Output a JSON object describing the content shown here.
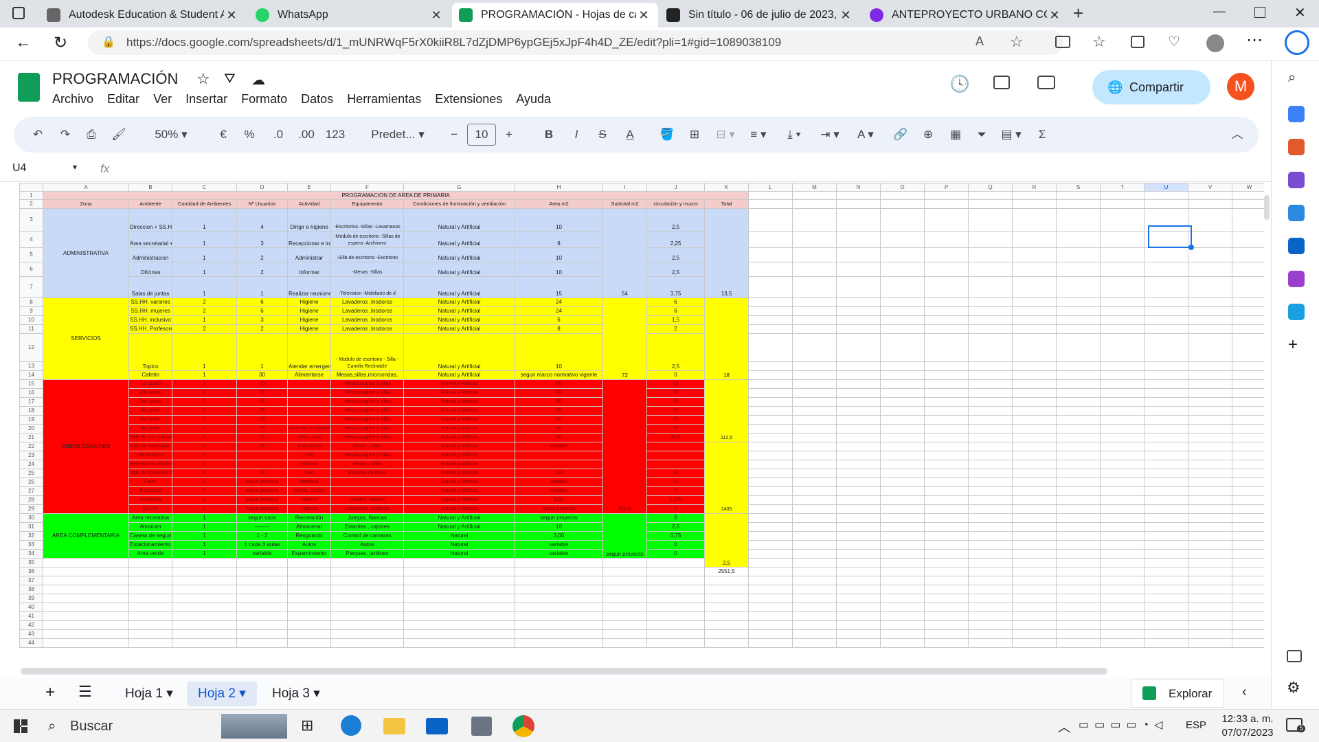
{
  "browser": {
    "tabs": [
      {
        "title": "Autodesk Education & Student A",
        "icon": "autodesk-icon",
        "color": "#666666"
      },
      {
        "title": "WhatsApp",
        "icon": "whatsapp-icon",
        "color": "#25d366"
      },
      {
        "title": "PROGRAMACIÓN - Hojas de cálc",
        "icon": "sheets-icon",
        "color": "#0f9d58"
      },
      {
        "title": "Sin título - 06 de julio de 2023, 1",
        "icon": "autodesk-a-icon",
        "color": "#222222"
      },
      {
        "title": "ANTEPROYECTO URBANO COLE",
        "icon": "canva-icon",
        "color": "#7d2ae8"
      }
    ],
    "url": "https://docs.google.com/spreadsheets/d/1_mUNRWqF5rX0kiiR8L7dZjDMP6ypGEj5xJpF4h4D_ZE/edit?pli=1#gid=1089038109"
  },
  "doc": {
    "title": "PROGRAMACIÓN",
    "menu": [
      "Archivo",
      "Editar",
      "Ver",
      "Insertar",
      "Formato",
      "Datos",
      "Herramientas",
      "Extensiones",
      "Ayuda"
    ],
    "share_label": "Compartir",
    "avatar_letter": "M"
  },
  "toolbar": {
    "zoom": "50%",
    "currency": "€",
    "percent": "%",
    "dec_less": ".0",
    "dec_more": ".00",
    "format_123": "123",
    "font": "Predet...",
    "font_size": "10",
    "bold": "B",
    "italic": "I",
    "strike": "S",
    "text_color": "A"
  },
  "formula_bar": {
    "cell_ref": "U4",
    "fx": "fx",
    "value": ""
  },
  "sheet": {
    "col_headers": [
      "A",
      "B",
      "C",
      "D",
      "E",
      "F",
      "G",
      "H",
      "I",
      "J",
      "K",
      "L",
      "M",
      "N",
      "O",
      "P",
      "Q",
      "R",
      "S",
      "T",
      "U",
      "V",
      "W"
    ],
    "row_numbers": [
      "1",
      "2",
      "3",
      "4",
      "5",
      "6",
      "7",
      "8",
      "9",
      "10",
      "11",
      "12",
      "13",
      "14",
      "15",
      "16",
      "17",
      "18",
      "19",
      "20",
      "21",
      "22",
      "23",
      "24",
      "25",
      "26",
      "27",
      "28",
      "29",
      "30",
      "31",
      "32",
      "33",
      "34",
      "35",
      "36",
      "37",
      "38",
      "39",
      "40",
      "41",
      "42",
      "43",
      "44"
    ],
    "title": "PROGRAMACION DE AREA DE PRIMARIA",
    "headers": [
      "Zona",
      "Ambiente",
      "Cantidad de Ambientes",
      "Nº Usuarios",
      "Actividad",
      "Equipamento",
      "Condiciones de Iluminación y ventilación",
      "Area m2",
      "Subtotal m2",
      "circulación y muros",
      "Total"
    ],
    "zones": {
      "admin": "ADMINISTRATIVA",
      "servicios": "SERVICIOS",
      "comunes": "AREAS COMUNES",
      "complementaria": "AREA COMPLEMENTARIA"
    },
    "admin_rows": [
      [
        "Direccion + SS.HH",
        "1",
        "4",
        "Dirigir e higiene",
        "-Escritorios -Sillas -Lavamanos",
        "Natural y Artificial",
        "10",
        "",
        "2,5",
        ""
      ],
      [
        "Area secretarial + recepcion",
        "1",
        "3",
        "Recepcionar e informar",
        "-Modulo de escritorio -Sillas de espera -Archivero",
        "Natural y Artificial",
        "9",
        "",
        "2,25",
        ""
      ],
      [
        "Administracion",
        "1",
        "2",
        "Administrar",
        "-Silla de escritorio -Escritorio",
        "Natural y Artificial",
        "10",
        "",
        "2,5",
        ""
      ],
      [
        "Oficinas",
        "1",
        "2",
        "Informar",
        "-Mesas -Sillas",
        "Natural y Artificial",
        "10",
        "",
        "2,5",
        ""
      ],
      [
        "Salas de juntas",
        "1",
        "1",
        "Realizar reuniones",
        "-Television -Mobiliario de d",
        "Natural y Artificial",
        "15",
        "54",
        "3,75",
        "13,5"
      ]
    ],
    "serv_rows": [
      [
        "SS.HH. varones",
        "2",
        "6",
        "Higiene",
        "Lavaderos ,Inodoros",
        "Natural y Artificial",
        "24",
        "",
        "6",
        ""
      ],
      [
        "SS.HH. mujeres",
        "2",
        "6",
        "Higiene",
        "Lavaderos ,Inodoros",
        "Natural y Artificial",
        "24",
        "",
        "6",
        ""
      ],
      [
        "SS.HH. inclusivo",
        "1",
        "3",
        "Higiene",
        "Lavaderos ,Inodoros",
        "Natural y Artificial",
        "6",
        "",
        "1,5",
        ""
      ],
      [
        "SS.HH. Profesores",
        "2",
        "2",
        "Higiene",
        "Lavaderos ,Inodoros",
        "Natural y Artificial",
        "8",
        "",
        "2",
        ""
      ],
      [
        "Topico",
        "1",
        "1",
        "Atender emergencias",
        "- Modulo de escritorio - Silla - Camilla Reclinable",
        "Natural y Artificial",
        "10",
        "",
        "2,5",
        ""
      ],
      [
        "Cafetin",
        "1",
        "30",
        "Alimentarse",
        "Mesas,sillas,microondas,",
        "Natural y Artificial",
        "segun marco normativo vigente",
        "72",
        "0",
        "18"
      ]
    ],
    "comunes_group_aulas": "Aula (espacio)",
    "comunes_group_biblio": "Biblioteca",
    "comunes_group_aud": "Auditorio",
    "comunes_rows": [
      [
        "1er grado",
        "2",
        "25",
        "",
        "-Mesas,pupitre y sillas",
        "Natural y Artificial",
        "60",
        "",
        "15",
        ""
      ],
      [
        "2do grado",
        "2",
        "25",
        "",
        "-Mesas,pupitre y sillas",
        "Natural y Artificial",
        "60",
        "",
        "15",
        ""
      ],
      [
        "3cer grado",
        "2",
        "25",
        "",
        "-Mesas,pupitre y sillas",
        "Natural y Artificial",
        "60",
        "",
        "15",
        ""
      ],
      [
        "4to grado",
        "2",
        "25",
        "",
        "-Mesas,pupitre y sillas",
        "Natural y Artificial",
        "60",
        "",
        "15",
        ""
      ],
      [
        "5to grado",
        "2",
        "25",
        "",
        "-Mesas,pupitre y sillas",
        "Natural y Artificial",
        "60",
        "",
        "15",
        ""
      ],
      [
        "6to grado",
        "2",
        "25",
        "Aprender y enseñar",
        "-Mesas,pupitre y sillas",
        "Natural y Artificial",
        "60",
        "",
        "15",
        ""
      ],
      [
        "Sala de uso multiple",
        "1",
        "25",
        "Varios usos",
        "-Mesas,pupitre y sillas",
        "Natural y Artificial",
        "90",
        "",
        "22,5",
        "112,5"
      ],
      [
        "Sala de exposicion",
        "1",
        "25",
        "Exposicion",
        "Mesas , sillas",
        "Natural y Artificial",
        "variable",
        "",
        "",
        ""
      ],
      [
        "Hemeroteca",
        "1",
        "",
        "Leer",
        "-Mesas,pupitre y sillas",
        "Natural y Artificial",
        "",
        "",
        "",
        ""
      ],
      [
        "Recepcion+ oficinas",
        "2",
        "",
        "Informar",
        "Mesas , sillas",
        "Natural y Artificial",
        "",
        "",
        "",
        ""
      ],
      [
        "Sala de coleccion de libros",
        "1",
        "60",
        "Leer",
        "Estantes de libros",
        "Natural y Artificial",
        "120",
        "",
        "30",
        ""
      ],
      [
        "Foyer",
        "1",
        "segun proyecto",
        "Distribuir",
        "",
        "Natural y Artificial",
        "variable",
        "",
        "0",
        ""
      ],
      [
        "Escenario",
        "1",
        "segun proyecto",
        "Contar, cantar,",
        "",
        "Natural y Artificial",
        "variable",
        "",
        "0",
        ""
      ],
      [
        "Vestidores",
        "1",
        "segun proyecto",
        "Vestirse",
        "Lockers, bancos",
        "Natural y Artificial",
        "9,50",
        "",
        "2,375",
        "2405"
      ],
      [
        "SS.HH.",
        "2",
        "segun proyecto",
        "Higiene",
        "Lavaderos ,Inodoros",
        "Natural y Artificial",
        "segun proyecto",
        "210,5",
        "0",
        ""
      ]
    ],
    "compl_rows": [
      [
        "Area recreativa",
        "1",
        "segun usos",
        "Recreación",
        "Juegos, Bancas",
        "Natural y Artificial",
        "segun proyecto",
        "",
        "0",
        ""
      ],
      [
        "Almacen",
        "1",
        "--------",
        "Almacenar",
        "Estantes , cajones",
        "Natural y Artificial",
        "10",
        "",
        "2,5",
        ""
      ],
      [
        "Caseta de seguridad",
        "1",
        "1 - 2",
        "Resguardo",
        "Control de camaras",
        "Natural",
        "3,00",
        "",
        "0,75",
        ""
      ],
      [
        "Estacionamiento",
        "1",
        "1 cada 3 aulas",
        "Autos",
        "Autos",
        "Natural",
        "variable",
        "",
        "0",
        ""
      ],
      [
        "Area verde",
        "1",
        "variable",
        "Esparcimiento",
        "Parques, jardines",
        "Natural",
        "variable",
        "segun proyecto",
        "0",
        ""
      ]
    ],
    "row35_total": "2,5",
    "grand_total": "2551,5"
  },
  "sheet_tabs": [
    "Hoja 1",
    "Hoja 2",
    "Hoja 3"
  ],
  "active_sheet": "Hoja 2",
  "explore_label": "Explorar",
  "taskbar": {
    "search_placeholder": "Buscar",
    "lang": "ESP",
    "time": "12:33 a. m.",
    "date": "07/07/2023",
    "notif_count": "5"
  },
  "colors": {
    "pink": "#f4cccc",
    "blue": "#c9daf8",
    "yellow": "#ffff00",
    "red": "#ff0000",
    "green": "#00ff00",
    "accent": "#0b57d0"
  }
}
